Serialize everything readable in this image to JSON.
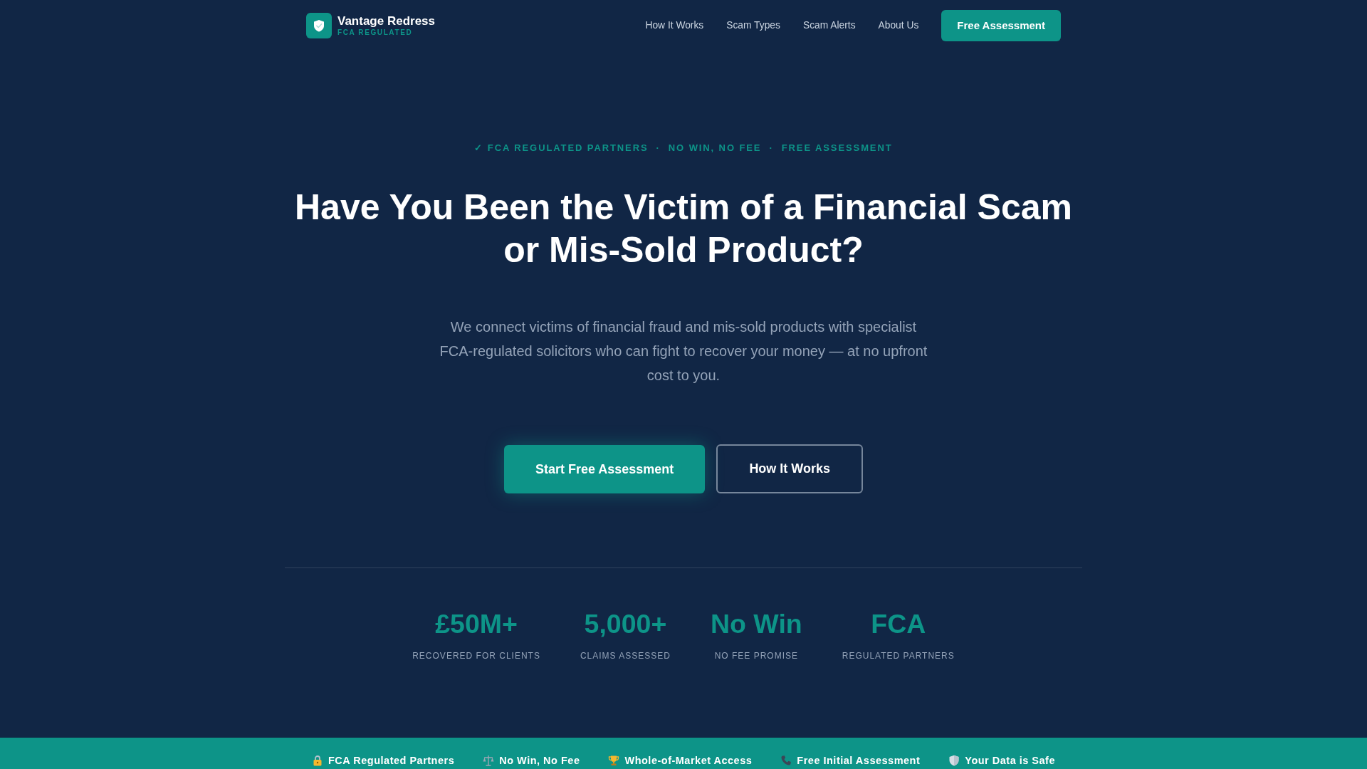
{
  "navbar": {
    "brand": {
      "name": "Vantage Redress",
      "tagline": "FCA REGULATED"
    },
    "links": [
      {
        "label": "How It Works"
      },
      {
        "label": "Scam Types"
      },
      {
        "label": "Scam Alerts"
      },
      {
        "label": "About Us"
      }
    ],
    "cta": "Free Assessment"
  },
  "hero": {
    "eyebrow": "✓ FCA REGULATED PARTNERS  ·  NO WIN, NO FEE  ·  FREE ASSESSMENT",
    "title": "Have You Been the Victim of a Financial Scam or Mis-Sold Product?",
    "lead": "We connect victims of financial fraud and mis-sold products with specialist FCA-regulated solicitors who can fight to recover your money — at no upfront cost to you.",
    "buttons": [
      {
        "label": "Start Free Assessment",
        "kind": "primary"
      },
      {
        "label": "How It Works",
        "kind": "outline"
      }
    ]
  },
  "stats": [
    {
      "value": "£50M+",
      "label": "RECOVERED FOR CLIENTS"
    },
    {
      "value": "5,000+",
      "label": "CLAIMS ASSESSED"
    },
    {
      "value": "No Win",
      "label": "NO FEE PROMISE"
    },
    {
      "value": "FCA",
      "label": "REGULATED PARTNERS"
    }
  ],
  "trust_bar": [
    {
      "kind": "lock",
      "label": "FCA Regulated Partners"
    },
    {
      "kind": "scales",
      "label": "No Win, No Fee"
    },
    {
      "kind": "trophy",
      "label": "Whole-of-Market Access"
    },
    {
      "kind": "phone",
      "label": "Free Initial Assessment"
    },
    {
      "kind": "shield",
      "label": "Your Data is Safe"
    }
  ]
}
